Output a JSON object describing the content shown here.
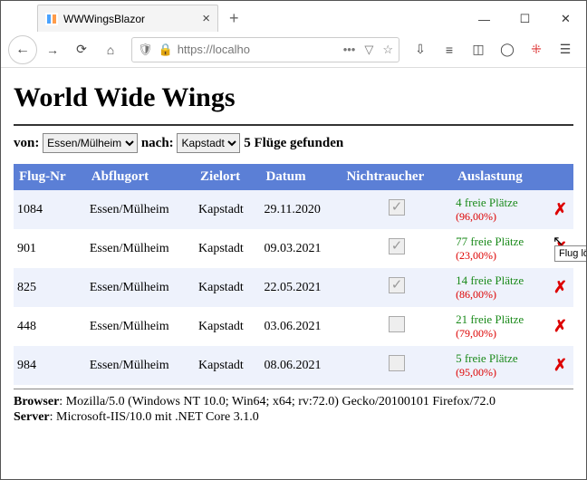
{
  "browser": {
    "tab_title": "WWWingsBlazor",
    "url_display": "https://localho",
    "tooltip_delete": "Flug löschen"
  },
  "page": {
    "title": "World Wide Wings",
    "from_label": "von:",
    "to_label": "nach:",
    "from_value": "Essen/Mülheim",
    "to_value": "Kapstadt",
    "result_text": "5 Flüge gefunden"
  },
  "table": {
    "headers": {
      "nr": "Flug-Nr",
      "dep": "Abflugort",
      "dest": "Zielort",
      "date": "Datum",
      "nosmok": "Nichtraucher",
      "load": "Auslastung"
    },
    "rows": [
      {
        "nr": "1084",
        "dep": "Essen/Mülheim",
        "dest": "Kapstadt",
        "date": "29.11.2020",
        "nosmok": true,
        "free": "4 freie Plätze",
        "pct": "(96,00%)",
        "tooltip": false
      },
      {
        "nr": "901",
        "dep": "Essen/Mülheim",
        "dest": "Kapstadt",
        "date": "09.03.2021",
        "nosmok": true,
        "free": "77 freie Plätze",
        "pct": "(23,00%)",
        "tooltip": true
      },
      {
        "nr": "825",
        "dep": "Essen/Mülheim",
        "dest": "Kapstadt",
        "date": "22.05.2021",
        "nosmok": true,
        "free": "14 freie Plätze",
        "pct": "(86,00%)",
        "tooltip": false
      },
      {
        "nr": "448",
        "dep": "Essen/Mülheim",
        "dest": "Kapstadt",
        "date": "03.06.2021",
        "nosmok": false,
        "free": "21 freie Plätze",
        "pct": "(79,00%)",
        "tooltip": false
      },
      {
        "nr": "984",
        "dep": "Essen/Mülheim",
        "dest": "Kapstadt",
        "date": "08.06.2021",
        "nosmok": false,
        "free": "5 freie Plätze",
        "pct": "(95,00%)",
        "tooltip": false
      }
    ]
  },
  "footer": {
    "browser_label": "Browser",
    "browser_value": "Mozilla/5.0 (Windows NT 10.0; Win64; x64; rv:72.0) Gecko/20100101 Firefox/72.0",
    "server_label": "Server",
    "server_value": "Microsoft-IIS/10.0 mit .NET Core 3.1.0"
  }
}
